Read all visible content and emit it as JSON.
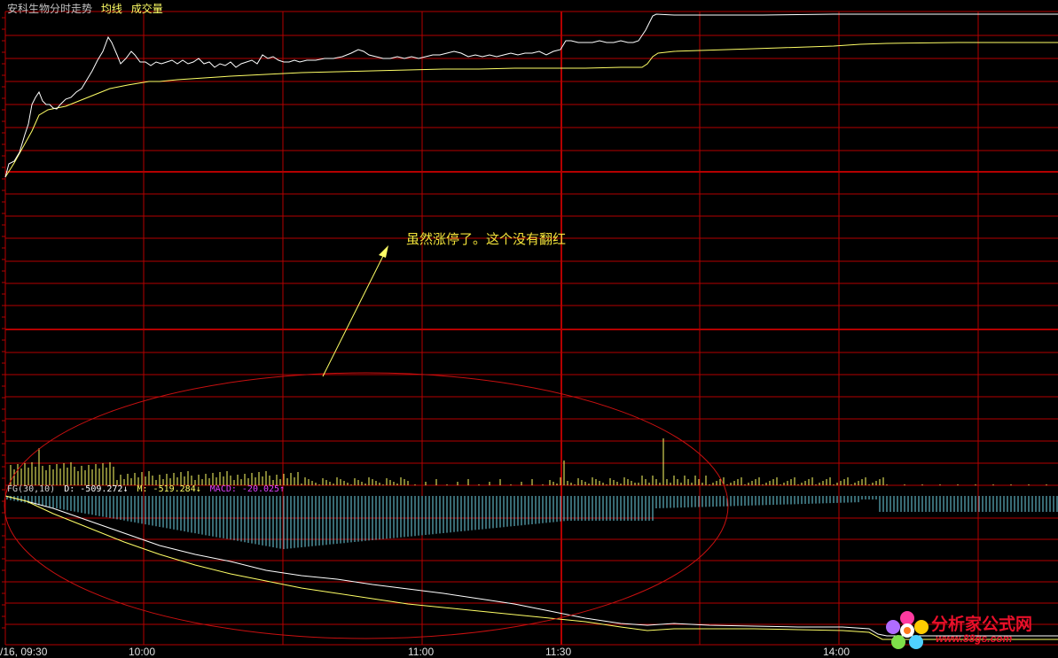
{
  "header": {
    "title": "安科生物分时走势",
    "avg_line_label": "均线",
    "volume_label": "成交量"
  },
  "indicator": {
    "name": "FG(30,10)",
    "d_text": "D: -509.272↓",
    "m_text": "M: -519.284↓",
    "macd_text": "MACD: -20.025↑"
  },
  "annotation": {
    "text": "虽然涨停了。这个没有翻红"
  },
  "xaxis": {
    "labels": [
      "/16, 09:30",
      "10:00",
      "11:00",
      "11:30",
      "14:00"
    ]
  },
  "watermark": {
    "title": "分析家公式网",
    "url": "www.88gs.com"
  },
  "colors": {
    "grid": "#b40000",
    "price_line": "#ffffff",
    "avg_line": "#ffff66",
    "volume_bars": "#ffff66",
    "macd_bars": "#6fd3e6",
    "annotation": "#f2e23a",
    "ellipse": "#c81010",
    "macd_text": "#e040ff",
    "brand": "#e8102a"
  }
}
